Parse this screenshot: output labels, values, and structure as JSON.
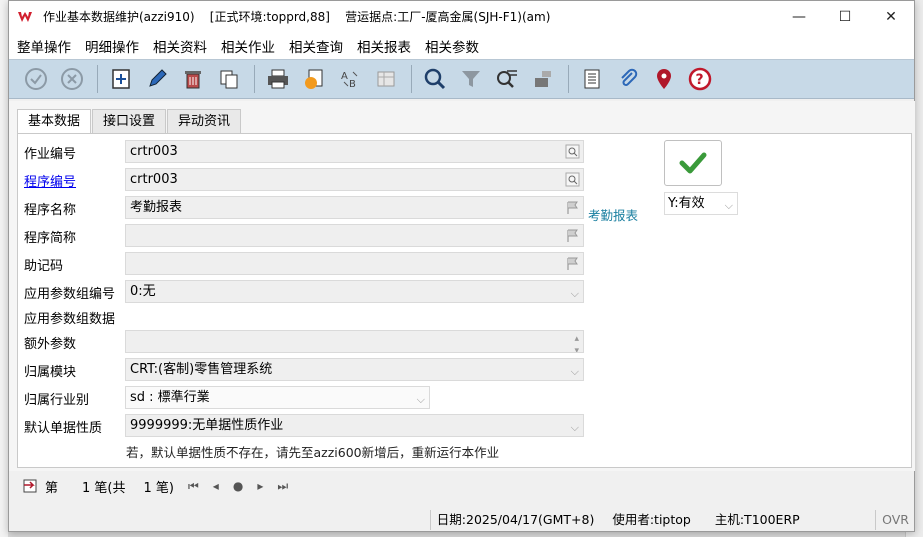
{
  "window": {
    "title": "作业基本数据维护(azzi910)    [正式环境:topprd,88]    营运据点:工厂-厦高金属(SJH-F1)(am)",
    "minimize": "—",
    "maximize": "☐",
    "close": "✕"
  },
  "menu": [
    "整单操作",
    "明细操作",
    "相关资料",
    "相关作业",
    "相关查询",
    "相关报表",
    "相关参数"
  ],
  "toolbar": {
    "icons": [
      "confirm-icon",
      "cancel-icon",
      "add-icon",
      "edit-icon",
      "delete-icon",
      "copy-icon",
      "print-icon",
      "export-icon",
      "convert-icon",
      "layout-icon",
      "search-icon",
      "filter-icon",
      "query-icon",
      "save-query-icon",
      "list-icon",
      "attach-icon",
      "location-icon",
      "help-icon"
    ]
  },
  "tabs": [
    "基本数据",
    "接口设置",
    "异动资讯"
  ],
  "form": {
    "job_no": {
      "label": "作业编号",
      "value": "crtr003"
    },
    "prog_no": {
      "label": "程序编号",
      "value": "crtr003",
      "side_text": "考勤报表"
    },
    "prog_name": {
      "label": "程序名称",
      "value": "考勤报表"
    },
    "prog_short": {
      "label": "程序简称",
      "value": ""
    },
    "mnemonic": {
      "label": "助记码",
      "value": ""
    },
    "param_group_no": {
      "label": "应用参数组编号",
      "value": "0:无"
    },
    "param_group_data": {
      "label": "应用参数组数据"
    },
    "extra_param": {
      "label": "额外参数",
      "value": ""
    },
    "module": {
      "label": "归属模块",
      "value": "CRT:(客制)零售管理系统"
    },
    "industry": {
      "label": "归属行业别",
      "value": "sd : 標準行業"
    },
    "doc_type": {
      "label": "默认单据性质",
      "value": "9999999:无单据性质作业"
    },
    "hint": "若，默认单据性质不存在，请先至azzi600新增后，重新运行本作业"
  },
  "status_flag": {
    "value": "Y:有效"
  },
  "nav": {
    "first_label": "第",
    "current": "1 笔(共",
    "total": "1 笔)"
  },
  "statusbar": {
    "date": "日期:2025/04/17(GMT+8)",
    "user": "使用者:tiptop",
    "host": "主机:T100ERP",
    "mode": "OVR"
  },
  "colors": {
    "toolbar_bg": "#c7d9e7",
    "link": "#0000ee",
    "check_green": "#3a9a3a",
    "brand_red": "#d11f2e"
  }
}
